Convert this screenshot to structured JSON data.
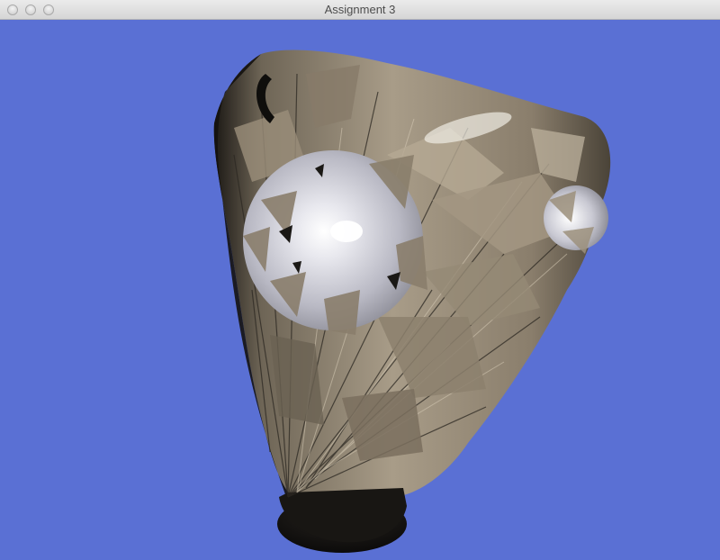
{
  "window": {
    "title": "Assignment 3",
    "buttons": {
      "close": "close-button",
      "minimize": "minimize-button",
      "zoom": "zoom-button"
    }
  },
  "scene": {
    "background_color": "#5a70d4",
    "object_base_color": "#8f8270",
    "highlight_color": "#ffffff",
    "dark_color": "#141210"
  }
}
